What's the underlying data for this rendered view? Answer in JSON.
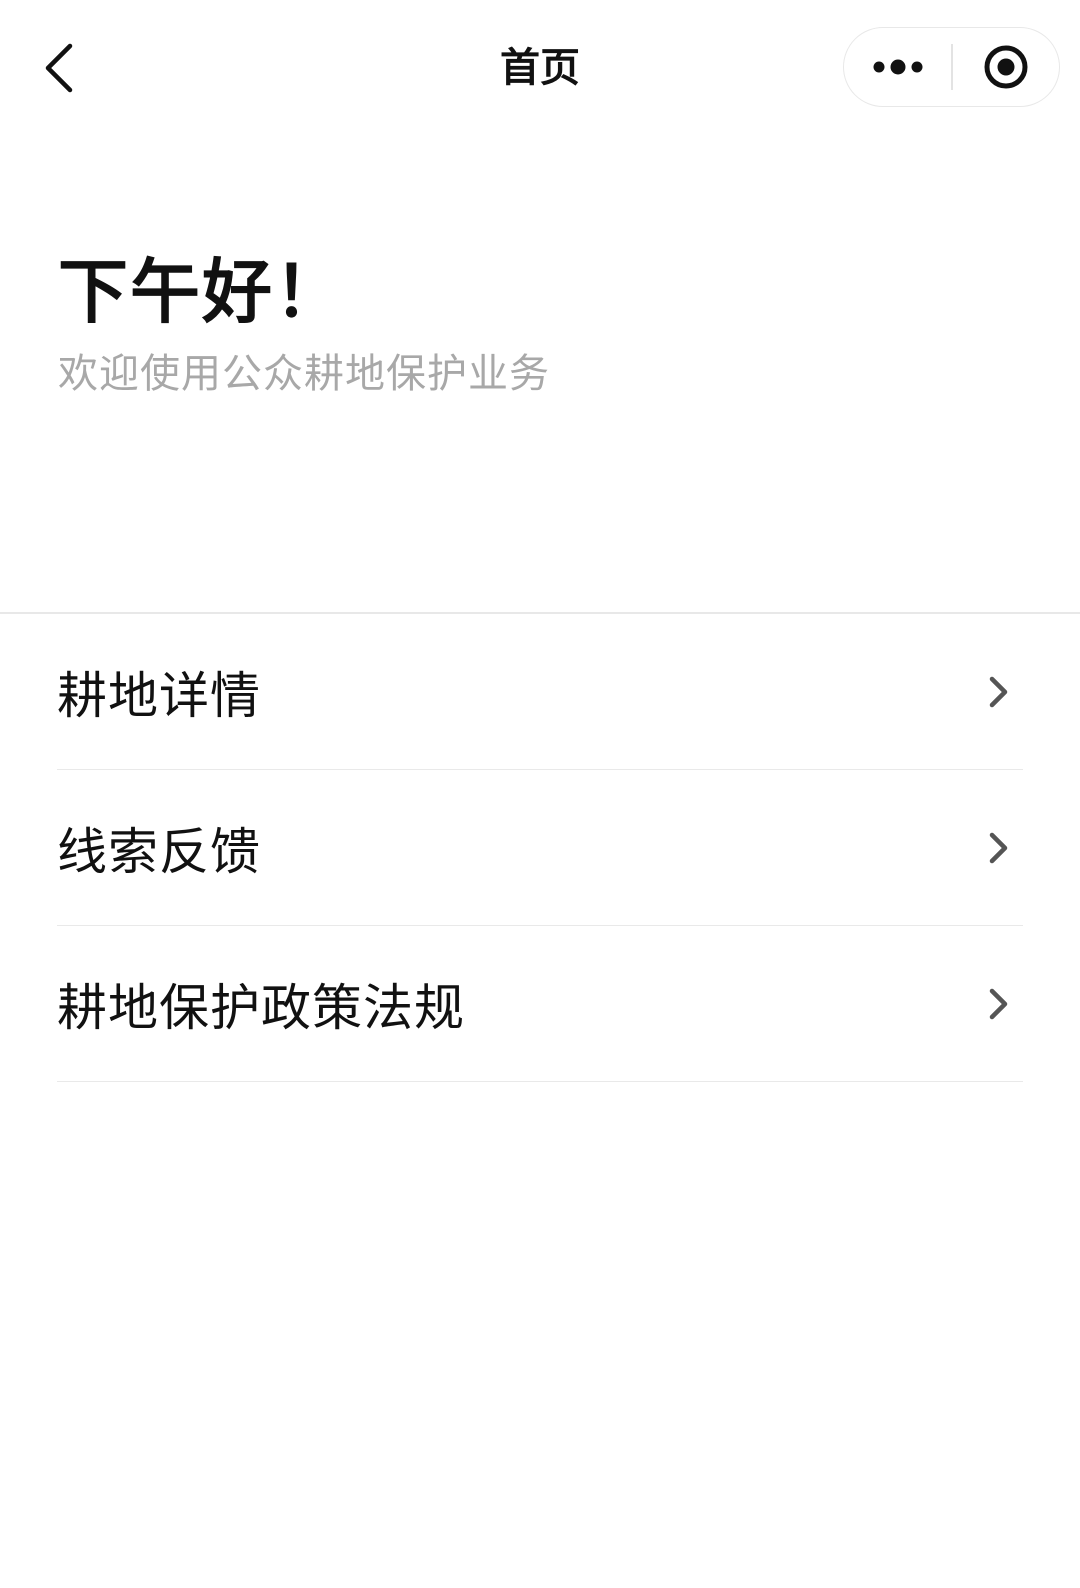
{
  "navbar": {
    "title": "首页",
    "back_icon": "chevron-left-icon",
    "more_icon": "more-dots-icon",
    "close_icon": "target-circle-icon"
  },
  "greeting": {
    "title": "下午好！",
    "subtitle": "欢迎使用公众耕地保护业务"
  },
  "menu": {
    "items": [
      {
        "label": "耕地详情",
        "icon": "chevron-right-icon"
      },
      {
        "label": "线索反馈",
        "icon": "chevron-right-icon"
      },
      {
        "label": "耕地保护政策法规",
        "icon": "chevron-right-icon"
      }
    ]
  },
  "colors": {
    "background": "#ffffff",
    "text_primary": "#111111",
    "text_secondary": "#a8a8a8",
    "divider": "#e8e8e8",
    "chevron": "#555555"
  }
}
